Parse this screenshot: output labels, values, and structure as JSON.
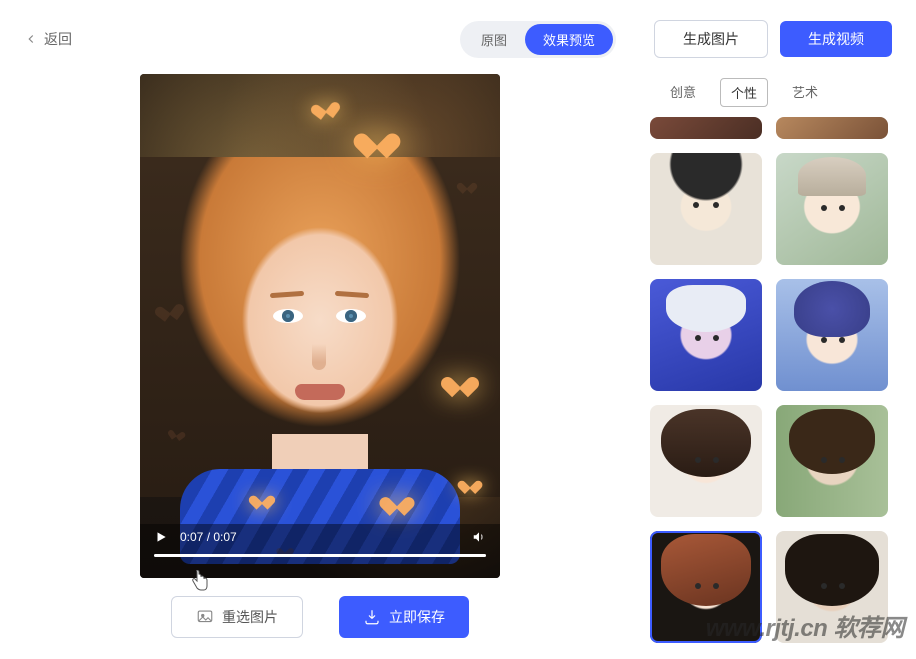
{
  "header": {
    "back_label": "返回",
    "toggle": {
      "original": "原图",
      "preview": "效果预览",
      "active": "preview"
    },
    "generate_image": "生成图片",
    "generate_video": "生成视频"
  },
  "video": {
    "time_current": "0:07",
    "time_total": "0:07",
    "time_display": "0:07 / 0:07"
  },
  "actions": {
    "rechoose": "重选图片",
    "save": "立即保存"
  },
  "style_tabs": {
    "items": [
      "创意",
      "个性",
      "艺术"
    ],
    "active_index": 1
  },
  "styles": {
    "selected_index": 7,
    "items": [
      {
        "name": "style-partial-a"
      },
      {
        "name": "style-partial-b"
      },
      {
        "name": "style-afro-bw"
      },
      {
        "name": "style-bucket-hat"
      },
      {
        "name": "style-neon-white"
      },
      {
        "name": "style-anime-blue"
      },
      {
        "name": "style-portrait-long"
      },
      {
        "name": "style-green-bokeh"
      },
      {
        "name": "style-redhead-dark"
      },
      {
        "name": "style-dark-wavy"
      }
    ]
  },
  "watermark": "www.rjtj.cn 软荐网",
  "colors": {
    "primary": "#3d5cff"
  }
}
